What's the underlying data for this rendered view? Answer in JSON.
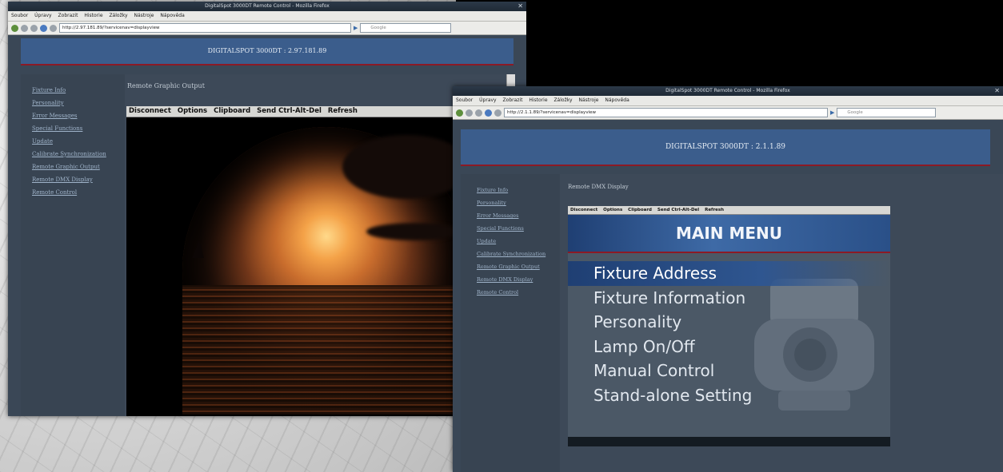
{
  "window_left": {
    "titlebar": "DigitalSpot 3000DT Remote Control - Mozilla Firefox",
    "menu": [
      "Soubor",
      "Úpravy",
      "Zobrazit",
      "Historie",
      "Záložky",
      "Nástroje",
      "Nápověda"
    ],
    "url": "http://2.97.181.89/?servicenav=displayview",
    "search_placeholder": "Google",
    "header": "DIGITALSPOT 3000DT : 2.97.181.89",
    "nav": [
      "Fixture Info",
      "Personality",
      "Error Messages",
      "Special Functions",
      "Update",
      "Calibrate Synchronization",
      "Remote Graphic Output",
      "Remote DMX Display",
      "Remote Control"
    ],
    "page_title": "Remote Graphic Output",
    "toolbar": [
      "Disconnect",
      "Options",
      "Clipboard",
      "Send Ctrl-Alt-Del",
      "Refresh"
    ]
  },
  "window_right": {
    "titlebar": "DigitalSpot 3000DT Remote Control - Mozilla Firefox",
    "menu": [
      "Soubor",
      "Úpravy",
      "Zobrazit",
      "Historie",
      "Záložky",
      "Nástroje",
      "Nápověda"
    ],
    "url": "http://2.1.1.89/?servicenav=displayview",
    "search_placeholder": "Google",
    "header": "DIGITALSPOT 3000DT : 2.1.1.89",
    "nav": [
      "Fixture Info",
      "Personality",
      "Error Messages",
      "Special Functions",
      "Update",
      "Calibrate Synchronization",
      "Remote Graphic Output",
      "Remote DMX Display",
      "Remote Control"
    ],
    "page_title": "Remote DMX Display",
    "toolbar": [
      "Disconnect",
      "Options",
      "Clipboard",
      "Send Ctrl-Alt-Del",
      "Refresh"
    ],
    "main_menu": {
      "title": "MAIN MENU",
      "items": [
        "Fixture Address",
        "Fixture Information",
        "Personality",
        "Lamp On/Off",
        "Manual Control",
        "Stand-alone Setting"
      ],
      "selected_index": 0
    }
  }
}
